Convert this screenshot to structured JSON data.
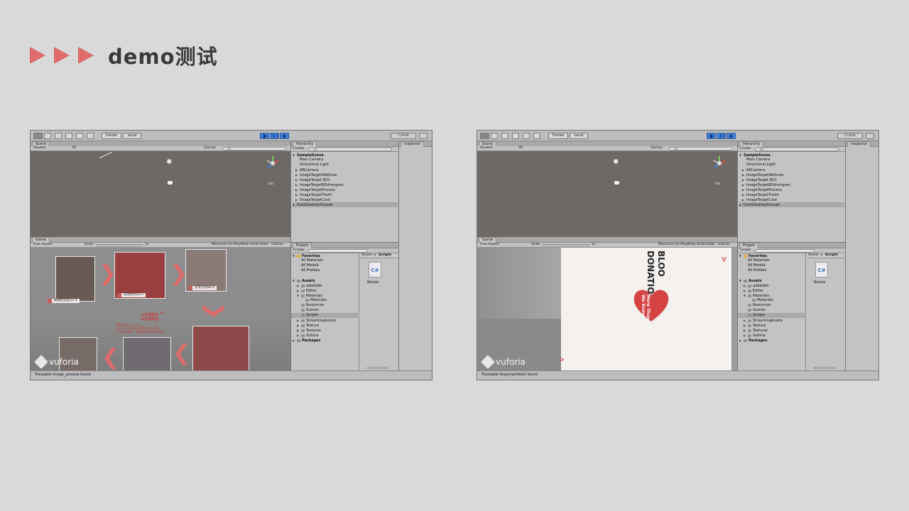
{
  "slide": {
    "title": "demo测试",
    "accent_color": "#df6b6b"
  },
  "unity_common": {
    "toolbar": {
      "pivot": "Center",
      "space": "Local",
      "collab": "Collab"
    },
    "scene": {
      "tab": "Scene",
      "shading": "Shaded",
      "mode_2d": "2D",
      "gizmos": "Gizmos",
      "search_placeholder": "All",
      "iso": "Iso"
    },
    "game": {
      "tab": "Game",
      "aspect": "Free Aspect",
      "scale_label": "Scale",
      "scale_value": "1x",
      "maximize": "Maximize On Play",
      "mute": "Mute Audio",
      "stats": "Stats",
      "gizmos": "Gizmos"
    },
    "hierarchy": {
      "tab": "Hierarchy",
      "create": "Create",
      "search_placeholder": "All",
      "items": [
        "SampleScene",
        "Main Camera",
        "Directional Light",
        "ARCamera",
        "ImageTargetWeKnow",
        "ImageTarget BD1",
        "ImageTargetBDzhongren",
        "ImageTargetProcess",
        "ImageTargetTiezhi",
        "ImageTargetCard",
        "DontDestroyOnLoad"
      ]
    },
    "project": {
      "tab": "Project",
      "create": "Create",
      "favorites": "Favorites",
      "favorite_items": [
        "All Materials",
        "All Models",
        "All Prefabs"
      ],
      "assets": "Assets",
      "asset_items": [
        "adddddd",
        "Editor",
        "Materials",
        "Materials",
        "Resources",
        "Scenes",
        "Scripts",
        "StreamingAssets",
        "Texture",
        "Textures",
        "Vuforia"
      ],
      "packages": "Packages",
      "breadcrumb_root": "Assets",
      "breadcrumb_sep": "▸",
      "breadcrumb_leaf": "Scripts",
      "file_icon": "C#",
      "file_name": "Rotate"
    },
    "inspector": {
      "tab": "Inspector"
    }
  },
  "unity_left": {
    "status": "Trackable Image_process found",
    "captions": [
      "解题纪念品10.4",
      "其他用材28.5",
      "负责包装86.6"
    ],
    "poster_text": {
      "headline_line1": "&无偿献血",
      "headline_line2": "&有偿用血",
      "yen": "¥",
      "body_line1": "数据来源：2/人/次",
      "body_line2": "2014—2015年血液费用中心资料",
      "body_line3": "平均人用血量，献血补偿献血补偿费用"
    },
    "vuforia": "vuforia"
  },
  "unity_right": {
    "status": "Trackable fengmianHeart found",
    "card": {
      "blood_line1": "BLOO",
      "blood_line2": "DONATION",
      "heart_line1": "More Than",
      "heart_line2": "We Know",
      "corner": "A"
    },
    "vuforia": "vuforia"
  }
}
